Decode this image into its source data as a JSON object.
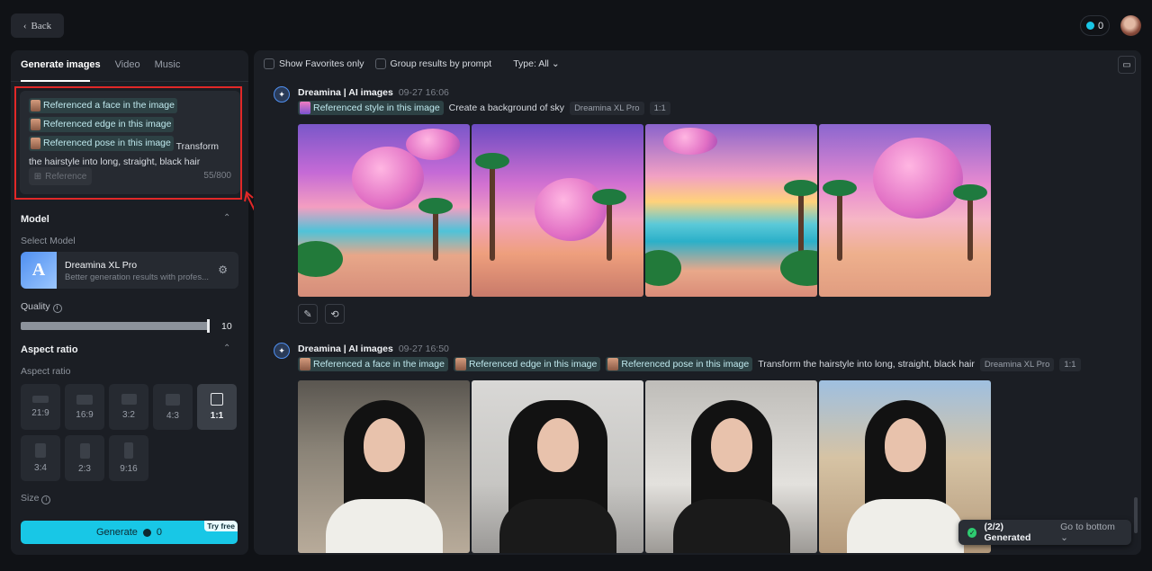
{
  "header": {
    "back_label": "Back",
    "credits": "0"
  },
  "left": {
    "tabs": [
      {
        "label": "Generate images",
        "active": true
      },
      {
        "label": "Video",
        "active": false
      },
      {
        "label": "Music",
        "active": false
      }
    ],
    "prompt": {
      "chips": [
        "Referenced a face in the image",
        "Referenced edge in this image",
        "Referenced pose in this image"
      ],
      "text": "Transform the hairstyle into long, straight, black hair",
      "reference_label": "Reference",
      "counter": "55/800"
    },
    "model": {
      "section_title": "Model",
      "select_label": "Select Model",
      "name": "Dreamina XL Pro",
      "description": "Better generation results with profes...",
      "logo_letter": "A"
    },
    "quality": {
      "label": "Quality",
      "value": "10",
      "max": 10
    },
    "aspect": {
      "section_title": "Aspect ratio",
      "label": "Aspect ratio",
      "options": [
        "21:9",
        "16:9",
        "3:2",
        "4:3",
        "1:1",
        "3:4",
        "2:3",
        "9:16"
      ],
      "selected": "1:1"
    },
    "size_label": "Size",
    "generate": {
      "label": "Generate",
      "cost": "0",
      "badge": "Try free"
    }
  },
  "main": {
    "toolbar": {
      "favorites_label": "Show Favorites only",
      "group_label": "Group results by prompt",
      "type_label": "Type: All"
    },
    "generations": [
      {
        "title": "Dreamina | AI images",
        "timestamp": "09-27  16:06",
        "chips": [
          "Referenced style in this image"
        ],
        "prompt": "Create a background of sky",
        "model_tag": "Dreamina XL Pro",
        "ratio_tag": "1:1"
      },
      {
        "title": "Dreamina | AI images",
        "timestamp": "09-27  16:50",
        "chips": [
          "Referenced a face in the image",
          "Referenced edge in this image",
          "Referenced pose in this image"
        ],
        "prompt": "Transform the hairstyle into long, straight, black hair",
        "model_tag": "Dreamina XL Pro",
        "ratio_tag": "1:1"
      }
    ],
    "toast": {
      "status": "(2/2) Generated",
      "action": "Go to bottom"
    }
  },
  "colors": {
    "accent": "#18c7e6",
    "highlight": "#e12828",
    "chip_bg": "#2d4144"
  }
}
